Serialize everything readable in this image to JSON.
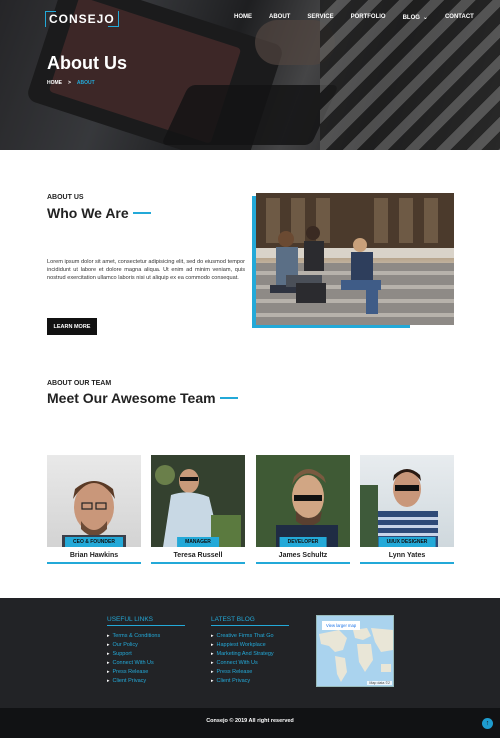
{
  "header": {
    "logo": "CONSEJO",
    "nav": [
      "HOME",
      "ABOUT",
      "SERVICE",
      "PORTFOLIO",
      "BLOG",
      "CONTACT"
    ],
    "title": "About Us",
    "breadcrumb": {
      "home": "HOME",
      "separator": ">",
      "current": "ABOUT"
    }
  },
  "about": {
    "subtitle": "ABOUT US",
    "title": "Who We Are",
    "paragraph": "Lorem ipsum dolor sit amet, consectetur adipisicing elit, sed do eiusmod tempor incididunt ut labore et dolore magna aliqua. Ut enim ad minim veniam, quis nostrud exercitation ullamco laboris nisi ut aliquip ex ea commodo consequat.",
    "button": "LEARN MORE"
  },
  "team": {
    "subtitle": "ABOUT OUR TEAM",
    "title": "Meet Our Awesome Team",
    "members": [
      {
        "name": "Brian Hawkins",
        "role": "CEO & FOUNDER"
      },
      {
        "name": "Teresa Russell",
        "role": "MANAGER"
      },
      {
        "name": "James Schultz",
        "role": "DEVELOPER"
      },
      {
        "name": "Lynn Yates",
        "role": "UI/UX DESIGNER"
      }
    ]
  },
  "footer": {
    "useful_links_title": "USEFUL LINKS",
    "useful_links": [
      "Terms & Conditions",
      "Our Policy",
      "Support",
      "Connect With Us",
      "Press Release",
      "Client Privacy"
    ],
    "latest_blog_title": "LATEST BLOG",
    "latest_blog": [
      "Creative Firms That Go",
      "Happiest Workplace",
      "Marketing And Strategy",
      "Connect With Us",
      "Press Release",
      "Client Privacy"
    ],
    "map_link": "View larger map",
    "map_footer": "Map data ©2",
    "copyright": "Consejo © 2019 All right reserved",
    "to_top_icon": "arrow-up-icon"
  },
  "colors": {
    "accent": "#23a9d8",
    "dark": "#222326",
    "black": "#111214"
  }
}
